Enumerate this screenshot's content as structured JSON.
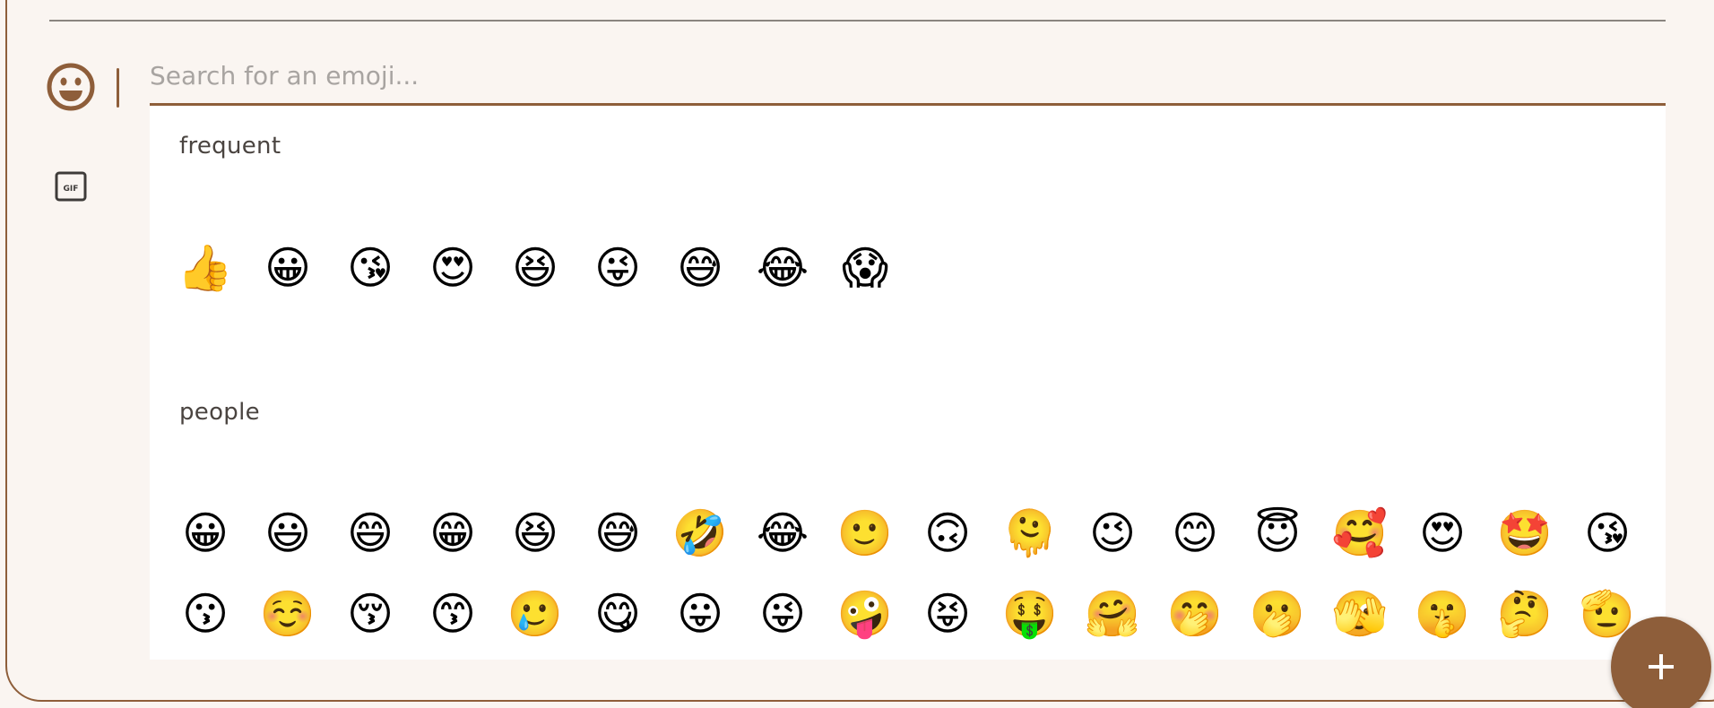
{
  "search": {
    "placeholder": "Search for an emoji..."
  },
  "icons": {
    "smiley": "smiley-face-icon",
    "gif": "gif-icon",
    "add": "plus-icon",
    "gif_text": "GIF"
  },
  "colors": {
    "accent": "#8e5e3a",
    "background": "#faf5f1",
    "panel": "#ffffff"
  },
  "sections": {
    "frequent": {
      "title": "frequent",
      "rows": [
        [
          "👍",
          "😀",
          "😘",
          "😍",
          "😆",
          "😜",
          "😅",
          "😂",
          "😱"
        ]
      ]
    },
    "people": {
      "title": "people",
      "rows": [
        [
          "😀",
          "😃",
          "😄",
          "😁",
          "😆",
          "😅",
          "🤣",
          "😂",
          "🙂",
          "🙃",
          "🫠",
          "😉",
          "😊",
          "😇",
          "🥰",
          "😍",
          "🤩",
          "😘"
        ],
        [
          "😗",
          "☺️",
          "😚",
          "😙",
          "🥲",
          "😋",
          "😛",
          "😜",
          "🤪",
          "😝",
          "🤑",
          "🤗",
          "🤭",
          "🫢",
          "🫣",
          "🤫",
          "🤔",
          "🫡"
        ],
        [
          "🤐",
          "🤨",
          "😐",
          "😑",
          "😶",
          "🫥",
          "😶‍🌫️",
          "😏",
          "😒",
          "🙄",
          "😬",
          "😮‍💨",
          "🤥",
          "🫨",
          "😌",
          "😔",
          "😪",
          "🤤"
        ]
      ]
    }
  }
}
